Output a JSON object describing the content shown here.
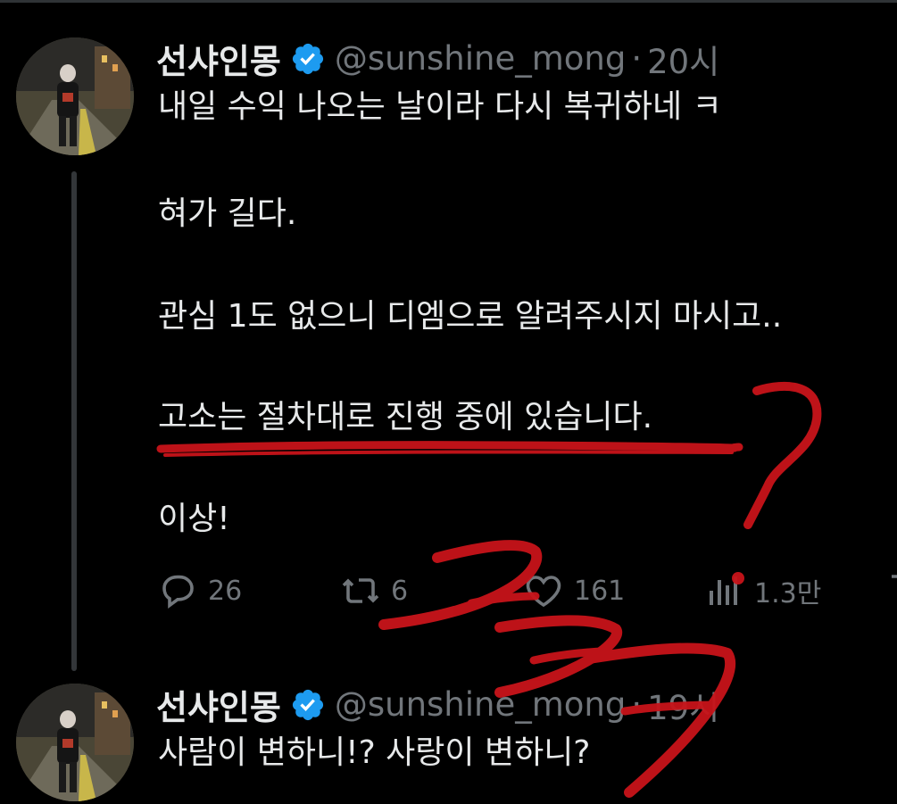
{
  "tweet1": {
    "display_name": "선샤인몽",
    "handle": "@sunshine_mong",
    "separator": "·",
    "time": "20시",
    "lines": [
      "내일 수익 나오는 날이라 다시 복귀하네 ㅋ",
      "혀가 길다.",
      "관심 1도 없으니 디엠으로 알려주시지 마시고..",
      "고소는 절차대로 진행 중에 있습니다.",
      "이상!"
    ],
    "actions": {
      "replies": "26",
      "retweets": "6",
      "likes": "161",
      "views": "1.3만"
    }
  },
  "tweet2": {
    "display_name": "선샤인몽",
    "handle": "@sunshine_mong",
    "separator": "·",
    "time": "19시",
    "text": "사람이 변하니!? 사랑이 변하니?"
  },
  "icons": {
    "verified": "verified-badge-icon",
    "reply": "reply-icon",
    "retweet": "retweet-icon",
    "like": "heart-icon",
    "views": "views-bar-chart-icon",
    "bookmark": "bookmark-icon"
  },
  "colors": {
    "background": "#000000",
    "text": "#e7e9ea",
    "secondary": "#71767b",
    "verified": "#1d9bf0",
    "annotation": "#c8141a"
  }
}
